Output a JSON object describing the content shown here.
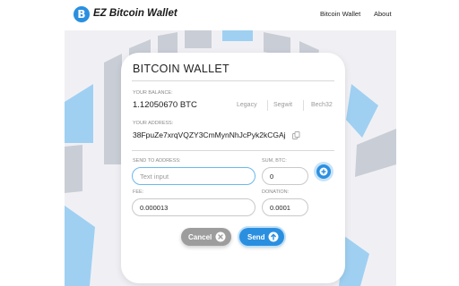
{
  "header": {
    "logo_letter": "B",
    "brand": "EZ Bitcoin Wallet",
    "nav": [
      "Bitcoin Wallet",
      "About"
    ]
  },
  "card": {
    "title": "BITCOIN WALLET",
    "balance_label": "YOUR BALANCE:",
    "balance_value": "1.12050670 BTC",
    "formats": [
      "Legacy",
      "Segwit",
      "Bech32"
    ],
    "address_label": "YOUR ADDRESS:",
    "address_value": "38FpuZe7xrqVQZY3CmMynNhJcPyk2kCGAj"
  },
  "form": {
    "send_to_label": "SEND TO ADDRESS:",
    "send_to_placeholder": "Text input",
    "send_to_value": "",
    "sum_label": "SUM, BTC:",
    "sum_value": "0",
    "fee_label": "FEE:",
    "fee_value": "0.000013",
    "donation_label": "DONATION:",
    "donation_value": "0.0001"
  },
  "actions": {
    "cancel_label": "Cancel",
    "send_label": "Send"
  },
  "colors": {
    "accent": "#2b8fe0",
    "cancel": "#9d9d9d",
    "background_panel": "#f0f0f4",
    "decoration_blue": "#9fd0f2",
    "decoration_gray": "#c9cdd6"
  },
  "icons": {
    "logo": "bitcoin-logo-icon",
    "copy": "copy-icon",
    "add": "plus-circle-icon",
    "cancel": "x-circle-icon",
    "send": "arrow-up-circle-icon"
  }
}
